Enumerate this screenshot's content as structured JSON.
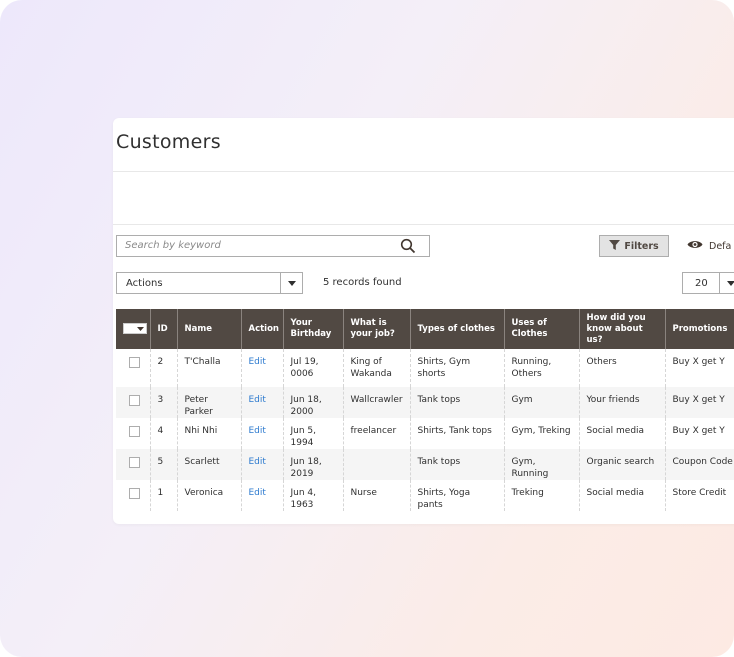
{
  "page": {
    "title": "Customers"
  },
  "toolbar": {
    "search_placeholder": "Search by keyword",
    "filters_label": "Filters",
    "default_view_label": "Defa"
  },
  "mass_actions": {
    "actions_label": "Actions",
    "records_found": "5 records found",
    "per_page": "20"
  },
  "grid": {
    "headers": {
      "id": "ID",
      "name": "Name",
      "action": "Action",
      "birthday": "Your Birthday",
      "job": "What is your job?",
      "clothes_types": "Types of clothes",
      "clothes_uses": "Uses of Clothes",
      "how_heard": "How did you know about  us?",
      "promotions": "Promotions"
    },
    "rows": [
      {
        "id": "2",
        "name": "T'Challa",
        "action": "Edit",
        "birthday": "Jul 19, 0006",
        "job": "King of Wakanda",
        "clothes_types": "Shirts, Gym shorts",
        "clothes_uses": "Running, Others",
        "how_heard": "Others",
        "promotions": "Buy X get Y"
      },
      {
        "id": "3",
        "name": "Peter Parker",
        "action": "Edit",
        "birthday": "Jun 18, 2000",
        "job": "Wallcrawler",
        "clothes_types": "Tank tops",
        "clothes_uses": "Gym",
        "how_heard": "Your friends",
        "promotions": "Buy X get Y"
      },
      {
        "id": "4",
        "name": "Nhi Nhi",
        "action": "Edit",
        "birthday": "Jun 5, 1994",
        "job": "freelancer",
        "clothes_types": "Shirts, Tank tops",
        "clothes_uses": "Gym, Treking",
        "how_heard": "Social media",
        "promotions": "Buy X get Y"
      },
      {
        "id": "5",
        "name": "Scarlett",
        "action": "Edit",
        "birthday": "Jun 18, 2019",
        "job": "",
        "clothes_types": "Tank tops",
        "clothes_uses": "Gym, Running",
        "how_heard": "Organic search",
        "promotions": "Coupon Code"
      },
      {
        "id": "1",
        "name": "Veronica",
        "action": "Edit",
        "birthday": "Jun 4, 1963",
        "job": "Nurse",
        "clothes_types": "Shirts,  Yoga  pants",
        "clothes_uses": "Treking",
        "how_heard": "Social media",
        "promotions": "Store Credit"
      }
    ]
  },
  "colors": {
    "header_bg": "#514943",
    "link": "#2e7bcf",
    "filters_bg": "#e3e3e3"
  },
  "icons": [
    "search-icon",
    "filter-icon",
    "eye-icon",
    "chevron-down-icon"
  ]
}
